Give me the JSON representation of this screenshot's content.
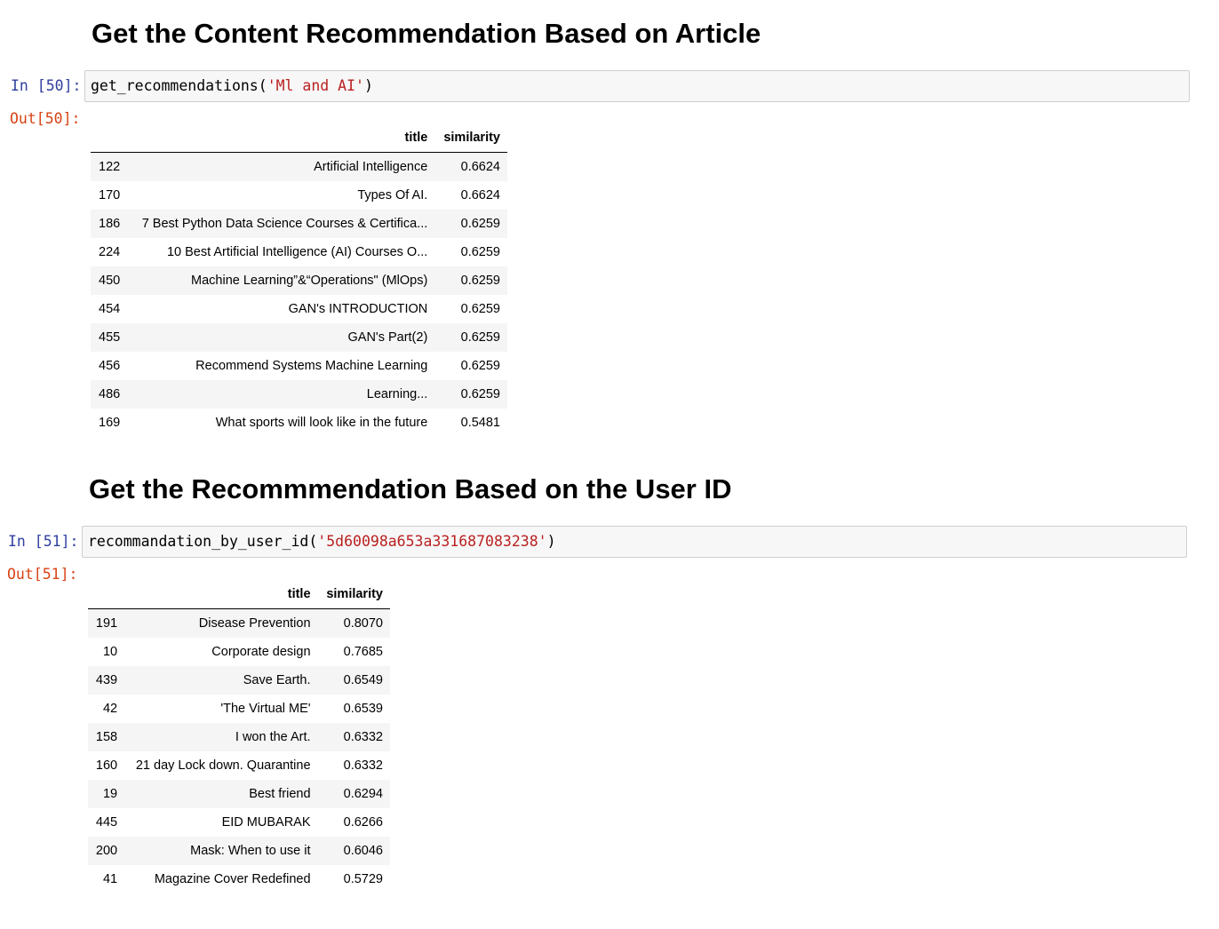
{
  "section1": {
    "heading": "Get the Content Recommendation Based on Article",
    "in_prompt": "In [50]:",
    "out_prompt": "Out[50]:",
    "code_func": "get_recommendations(",
    "code_arg": "'Ml and AI'",
    "code_close": ")",
    "table": {
      "columns": [
        "title",
        "similarity"
      ],
      "rows": [
        {
          "index": "122",
          "title": "Artificial Intelligence",
          "similarity": "0.6624"
        },
        {
          "index": "170",
          "title": "Types Of AI.",
          "similarity": "0.6624"
        },
        {
          "index": "186",
          "title": "7 Best Python Data Science Courses & Certifica...",
          "similarity": "0.6259"
        },
        {
          "index": "224",
          "title": "10 Best Artificial Intelligence (AI) Courses O...",
          "similarity": "0.6259"
        },
        {
          "index": "450",
          "title": "Machine Learning”&“Operations\" (MlOps)",
          "similarity": "0.6259"
        },
        {
          "index": "454",
          "title": "GAN's INTRODUCTION",
          "similarity": "0.6259"
        },
        {
          "index": "455",
          "title": "GAN's Part(2)",
          "similarity": "0.6259"
        },
        {
          "index": "456",
          "title": "Recommend Systems Machine Learning",
          "similarity": "0.6259"
        },
        {
          "index": "486",
          "title": "Learning...",
          "similarity": "0.6259"
        },
        {
          "index": "169",
          "title": "What sports will look like in the future",
          "similarity": "0.5481"
        }
      ]
    }
  },
  "section2": {
    "heading": "Get the Recommmendation Based on the User ID",
    "in_prompt": "In [51]:",
    "out_prompt": "Out[51]:",
    "code_func": "recommandation_by_user_id(",
    "code_arg": "'5d60098a653a331687083238'",
    "code_close": ")",
    "table": {
      "columns": [
        "title",
        "similarity"
      ],
      "rows": [
        {
          "index": "191",
          "title": "Disease Prevention",
          "similarity": "0.8070"
        },
        {
          "index": "10",
          "title": "Corporate design",
          "similarity": "0.7685"
        },
        {
          "index": "439",
          "title": "Save Earth.",
          "similarity": "0.6549"
        },
        {
          "index": "42",
          "title": "'The Virtual ME'",
          "similarity": "0.6539"
        },
        {
          "index": "158",
          "title": "I won the Art.",
          "similarity": "0.6332"
        },
        {
          "index": "160",
          "title": "21 day Lock down. Quarantine",
          "similarity": "0.6332"
        },
        {
          "index": "19",
          "title": "Best friend",
          "similarity": "0.6294"
        },
        {
          "index": "445",
          "title": "EID MUBARAK",
          "similarity": "0.6266"
        },
        {
          "index": "200",
          "title": "Mask: When to use it",
          "similarity": "0.6046"
        },
        {
          "index": "41",
          "title": "Magazine Cover Redefined",
          "similarity": "0.5729"
        }
      ]
    }
  }
}
